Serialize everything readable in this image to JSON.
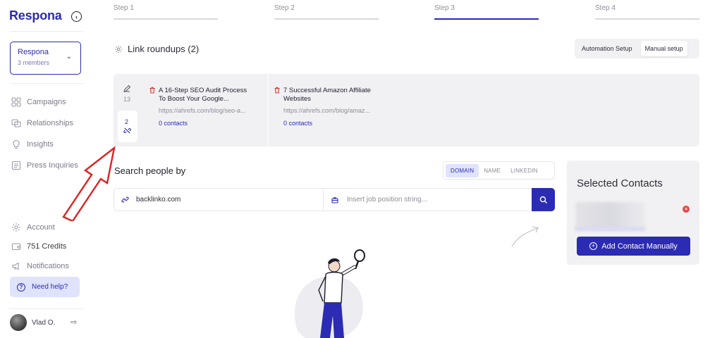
{
  "app": {
    "name": "Respona"
  },
  "team": {
    "name": "Respona",
    "members": "3 members"
  },
  "nav": {
    "campaigns": "Campaigns",
    "relationships": "Relationships",
    "insights": "Insights",
    "press_inquiries": "Press Inquiries",
    "account": "Account",
    "credits": "751 Credits",
    "notifications": "Notifications",
    "need_help": "Need help?"
  },
  "user": {
    "name": "Vlad O."
  },
  "steps": [
    "Step 1",
    "Step 2",
    "Step 3",
    "Step 4"
  ],
  "active_step": 3,
  "section": {
    "title": "Link roundups (2)",
    "mode_options": [
      "Automation Setup",
      "Manual setup"
    ],
    "active_mode": "Manual setup"
  },
  "counters": {
    "total": "13",
    "selected": "2"
  },
  "roundups": [
    {
      "title_line1": "A 16-Step SEO Audit Process",
      "title_line2": "To Boost Your Google...",
      "url": "https://ahrefs.com/blog/seo-a...",
      "contacts": "0 contacts"
    },
    {
      "title_line1": "7 Successful Amazon Affiliate",
      "title_line2": "Websites",
      "url": "https://ahrefs.com/blog/amaz...",
      "contacts": "0 contacts"
    }
  ],
  "search": {
    "label": "Search people by",
    "types": [
      "DOMAIN",
      "NAME",
      "LINKEDIN"
    ],
    "active_type": "DOMAIN",
    "domain_value": "backlinko.com",
    "position_placeholder": "Insert job position string..."
  },
  "selected_contacts": {
    "title": "Selected Contacts",
    "add_button": "Add Contact Manually"
  },
  "colors": {
    "accent": "#2b2bb3",
    "panel": "#f1f1f3",
    "danger": "#d83434",
    "annotation_arrow": "#e02020"
  }
}
